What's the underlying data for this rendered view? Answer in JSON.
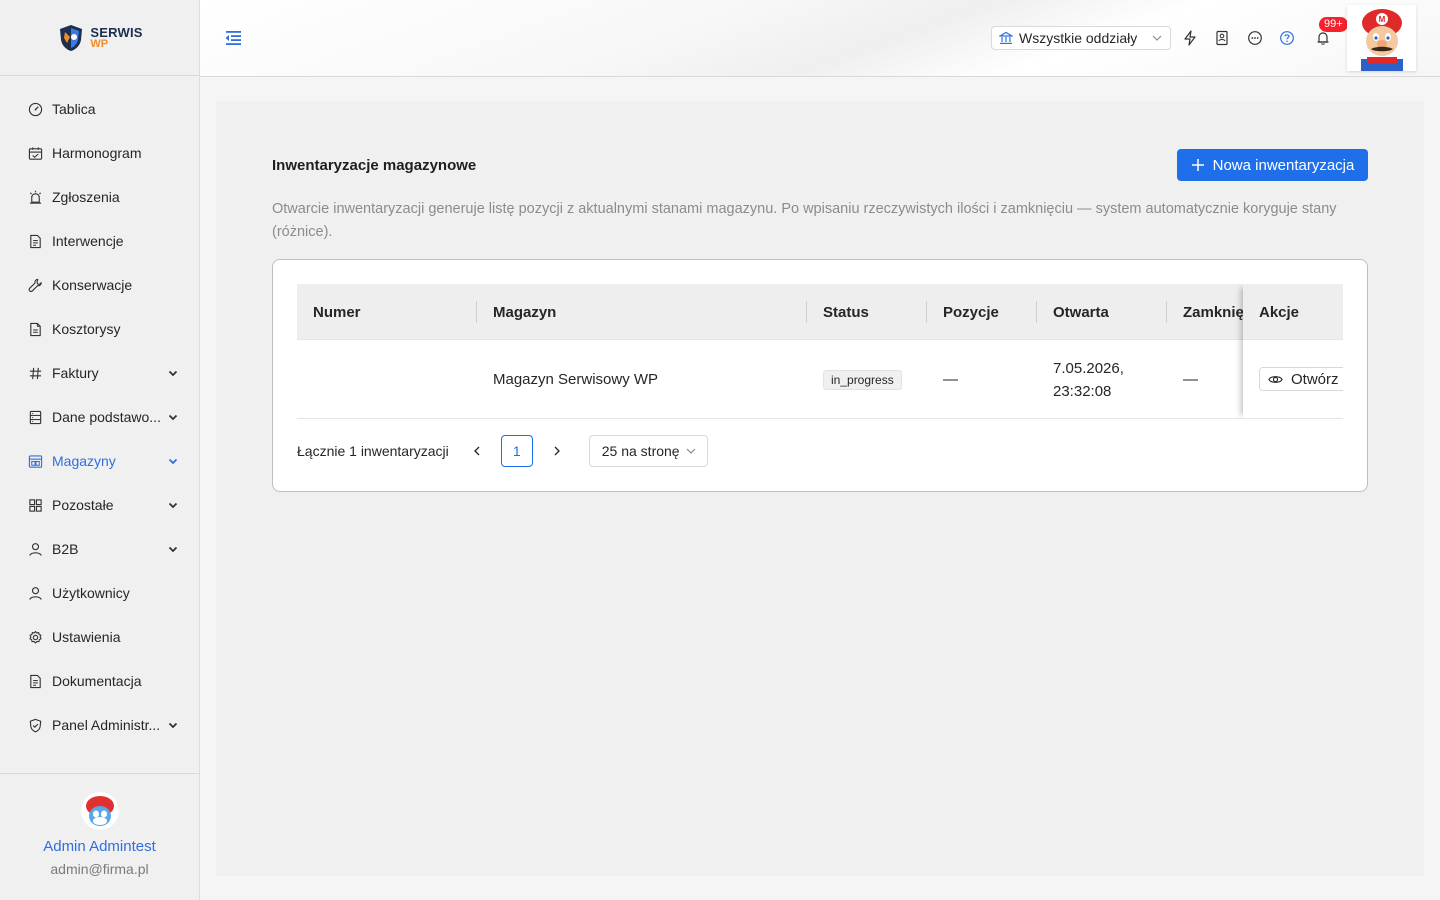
{
  "app": {
    "logo_line1": "SERWIS",
    "logo_line2": "WP",
    "brand_color": "#1f6feb"
  },
  "sidebar": {
    "items": [
      {
        "label": "Tablica",
        "icon": "dashboard-icon",
        "expandable": false,
        "active": false
      },
      {
        "label": "Harmonogram",
        "icon": "calendar-icon",
        "expandable": false,
        "active": false
      },
      {
        "label": "Zgłoszenia",
        "icon": "alarm-icon",
        "expandable": false,
        "active": false
      },
      {
        "label": "Interwencje",
        "icon": "document-icon",
        "expandable": false,
        "active": false
      },
      {
        "label": "Konserwacje",
        "icon": "wrench-icon",
        "expandable": false,
        "active": false
      },
      {
        "label": "Kosztorysy",
        "icon": "file-icon",
        "expandable": false,
        "active": false
      },
      {
        "label": "Faktury",
        "icon": "hash-icon",
        "expandable": true,
        "active": false
      },
      {
        "label": "Dane podstawo...",
        "icon": "database-icon",
        "expandable": true,
        "active": false
      },
      {
        "label": "Magazyny",
        "icon": "warehouse-icon",
        "expandable": true,
        "active": true
      },
      {
        "label": "Pozostałe",
        "icon": "grid-icon",
        "expandable": true,
        "active": false
      },
      {
        "label": "B2B",
        "icon": "user-icon",
        "expandable": true,
        "active": false
      },
      {
        "label": "Użytkownicy",
        "icon": "user-icon",
        "expandable": false,
        "active": false
      },
      {
        "label": "Ustawienia",
        "icon": "gear-icon",
        "expandable": false,
        "active": false
      },
      {
        "label": "Dokumentacja",
        "icon": "document-icon",
        "expandable": false,
        "active": false
      },
      {
        "label": "Panel Administr...",
        "icon": "shield-check-icon",
        "expandable": true,
        "active": false
      }
    ]
  },
  "user": {
    "name": "Admin Admintest",
    "email": "admin@firma.pl"
  },
  "header": {
    "branch_select": "Wszystkie oddziały",
    "notification_badge": "99+",
    "icons": [
      "lightning-icon",
      "contact-card-icon",
      "chat-icon",
      "help-icon",
      "bell-icon"
    ]
  },
  "page": {
    "title": "Inwentaryzacje magazynowe",
    "new_button": "Nowa inwentaryzacja",
    "description": "Otwarcie inwentaryzacji generuje listę pozycji z aktualnymi stanami magazynu. Po wpisaniu rzeczywistych ilości i zamknięciu — system automatycznie koryguje stany (różnice)."
  },
  "table": {
    "columns": [
      "Numer",
      "Magazyn",
      "Status",
      "Pozycje",
      "Otwarta",
      "Zamknięta",
      "Akcje"
    ],
    "rows": [
      {
        "numer": "",
        "magazyn": "Magazyn Serwisowy WP",
        "status": "in_progress",
        "pozycje": "—",
        "otwarta_line1": "7.05.2026,",
        "otwarta_line2": "23:32:08",
        "zamknieta": "—",
        "action": "Otwórz"
      }
    ]
  },
  "pagination": {
    "total": "Łącznie 1 inwentaryzacji",
    "current_page": "1",
    "page_size": "25 na stronę"
  }
}
